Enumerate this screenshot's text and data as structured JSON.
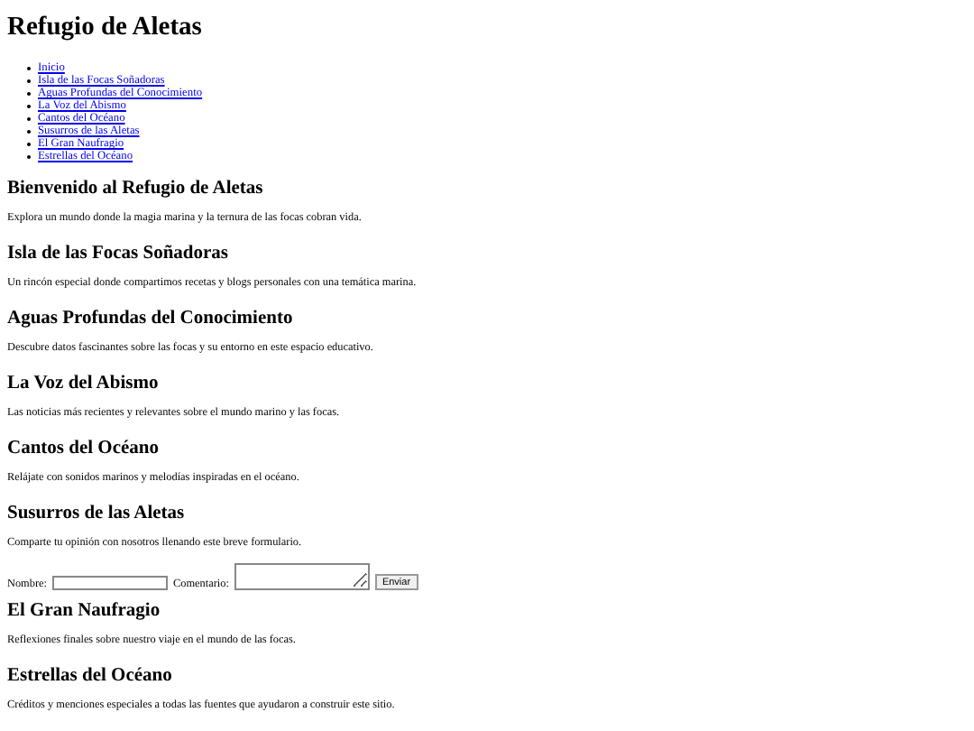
{
  "site_title": "Refugio de Aletas",
  "nav": [
    {
      "label": "Inicio"
    },
    {
      "label": "Isla de las Focas Soñadoras"
    },
    {
      "label": "Aguas Profundas del Conocimiento"
    },
    {
      "label": "La Voz del Abismo"
    },
    {
      "label": "Cantos del Océano"
    },
    {
      "label": "Susurros de las Aletas"
    },
    {
      "label": "El Gran Naufragio"
    },
    {
      "label": "Estrellas del Océano"
    }
  ],
  "sections": [
    {
      "heading": "Bienvenido al Refugio de Aletas",
      "text": "Explora un mundo donde la magia marina y la ternura de las focas cobran vida."
    },
    {
      "heading": "Isla de las Focas Soñadoras",
      "text": "Un rincón especial donde compartimos recetas y blogs personales con una temática marina."
    },
    {
      "heading": "Aguas Profundas del Conocimiento",
      "text": "Descubre datos fascinantes sobre las focas y su entorno en este espacio educativo."
    },
    {
      "heading": "La Voz del Abismo",
      "text": "Las noticias más recientes y relevantes sobre el mundo marino y las focas."
    },
    {
      "heading": "Cantos del Océano",
      "text": "Relájate con sonidos marinos y melodías inspiradas en el océano."
    },
    {
      "heading": "Susurros de las Aletas",
      "text": "Comparte tu opinión con nosotros llenando este breve formulario.",
      "form": {
        "fields": [
          {
            "label": "Nombre:",
            "kind": "input"
          },
          {
            "label": "Comentario:",
            "kind": "textarea"
          }
        ],
        "button": "Enviar"
      }
    },
    {
      "heading": "El Gran Naufragio",
      "text": "Reflexiones finales sobre nuestro viaje en el mundo de las focas."
    },
    {
      "heading": "Estrellas del Océano",
      "text": "Créditos y menciones especiales a todas las fuentes que ayudaron a construir este sitio."
    }
  ]
}
